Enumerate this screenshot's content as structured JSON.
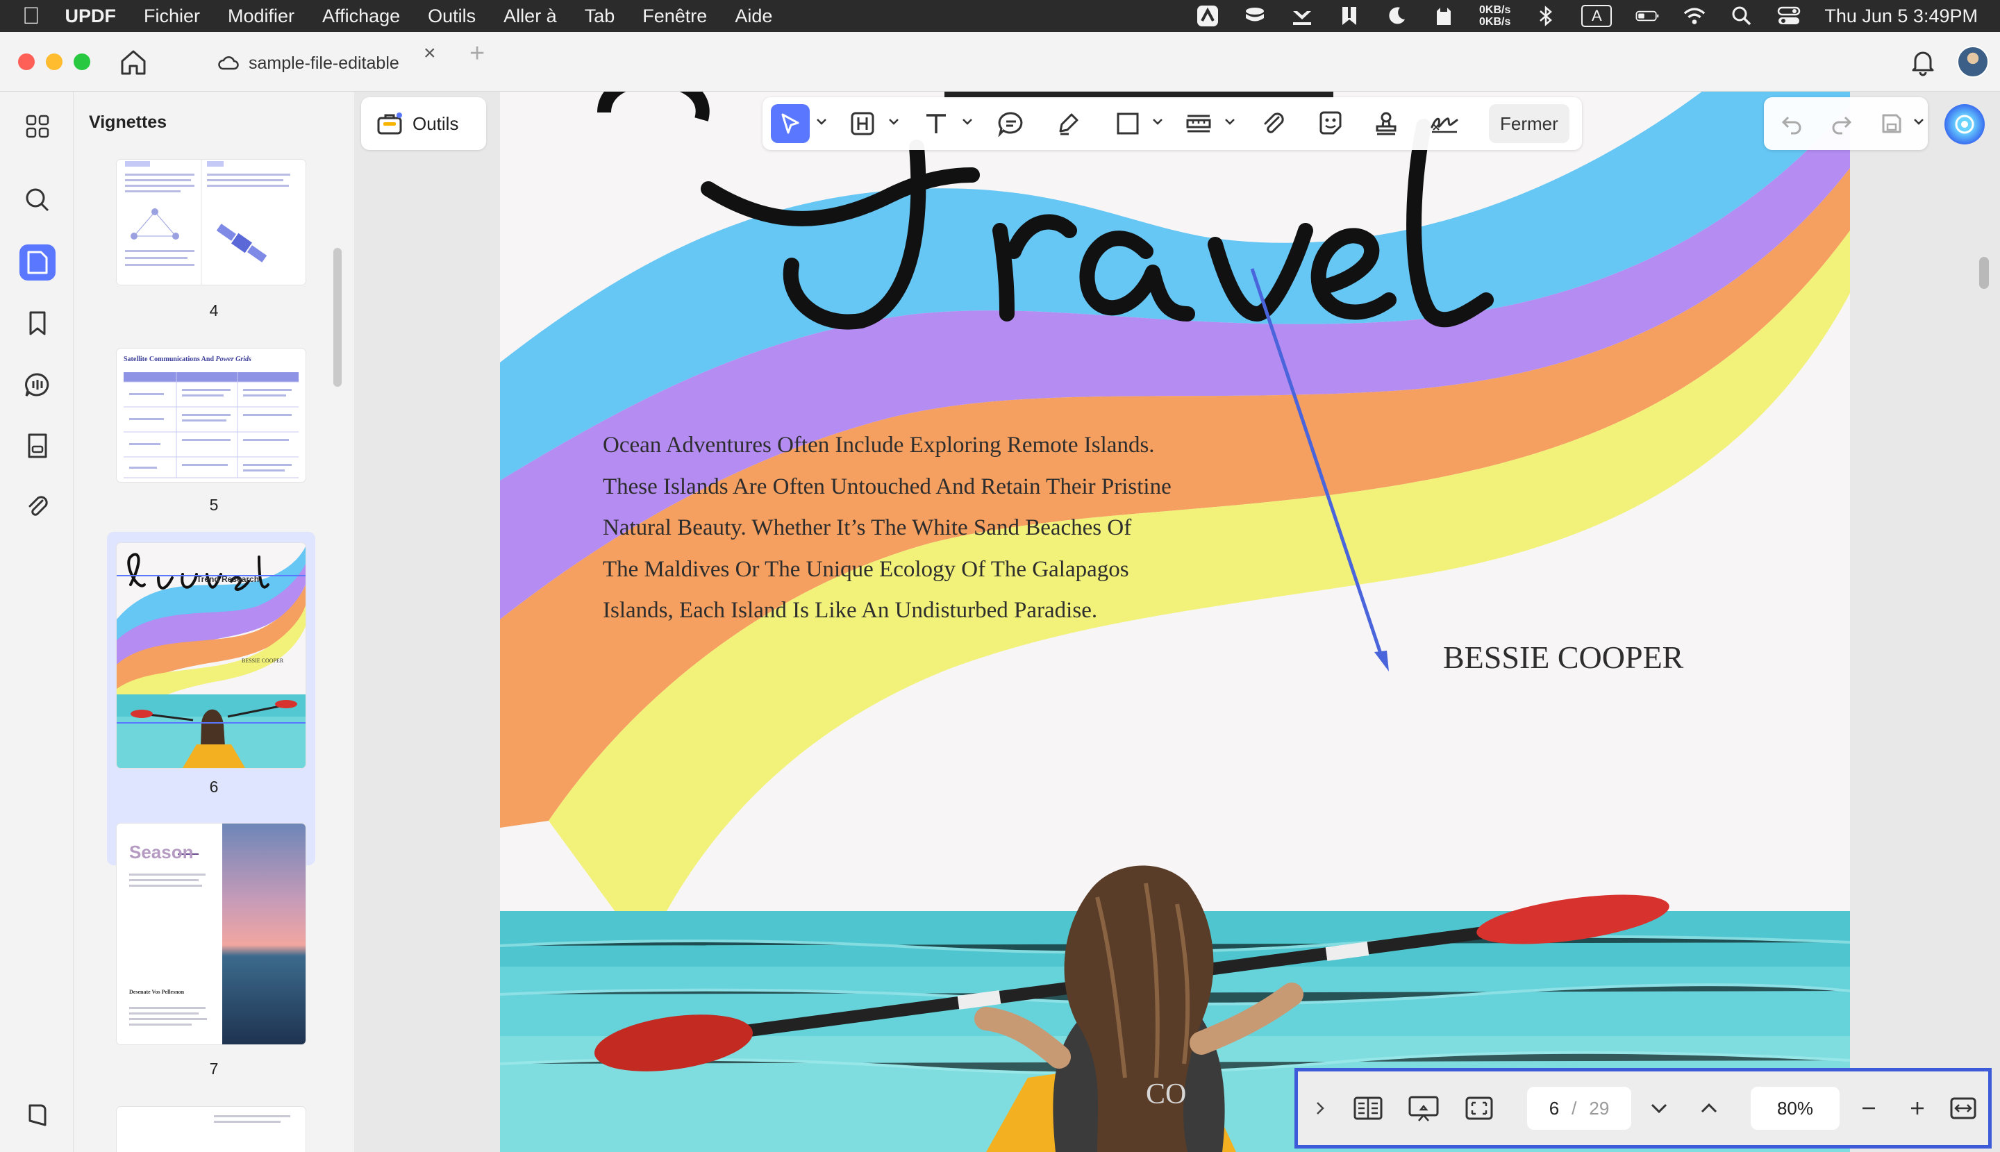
{
  "menubar": {
    "app_name": "UPDF",
    "items": [
      "Fichier",
      "Modifier",
      "Affichage",
      "Outils",
      "Aller à",
      "Tab",
      "Fenêtre",
      "Aide"
    ],
    "netspeed_up": "0KB/s",
    "netspeed_down": "0KB/s",
    "input_indicator": "A",
    "clock": "Thu Jun 5  3:49PM"
  },
  "tab": {
    "title": "sample-file-editable"
  },
  "sidebar": {
    "title": "Vignettes"
  },
  "thumbnails": [
    {
      "page": "4"
    },
    {
      "page": "5",
      "heading": "Satellite Communications And",
      "heading_italic": "Power Grids"
    },
    {
      "page": "6",
      "title": "Travel",
      "subtitle": "Trend Research",
      "author": "BESSIE COOPER"
    },
    {
      "page": "7",
      "title": "Season",
      "caption": "Desenate Vos Pellesnon"
    }
  ],
  "main": {
    "tools_label": "Outils"
  },
  "document": {
    "title_script": "Travel",
    "body": "Ocean Adventures Often Include Exploring Remote Islands. These Islands Are Often Untouched And Retain Their Pristine Natural Beauty. Whether It’s The White Sand Beaches Of The Maldives Or The Unique Ecology Of The Galapagos Islands, Each Island Is Like An Undisturbed Paradise.",
    "author": "BESSIE COOPER",
    "kayak_text": "CO"
  },
  "toolbar": {
    "close_label": "Fermer"
  },
  "nav": {
    "current_page": "6",
    "separator": "/",
    "total_pages": "29",
    "zoom": "80%"
  },
  "colors": {
    "accent": "#5a78ff",
    "highlight_border": "#3d5bd9",
    "wave_blue": "#66c6f4",
    "wave_purple": "#b48cf2",
    "wave_orange": "#f5a060",
    "wave_yellow": "#f2f27a"
  }
}
